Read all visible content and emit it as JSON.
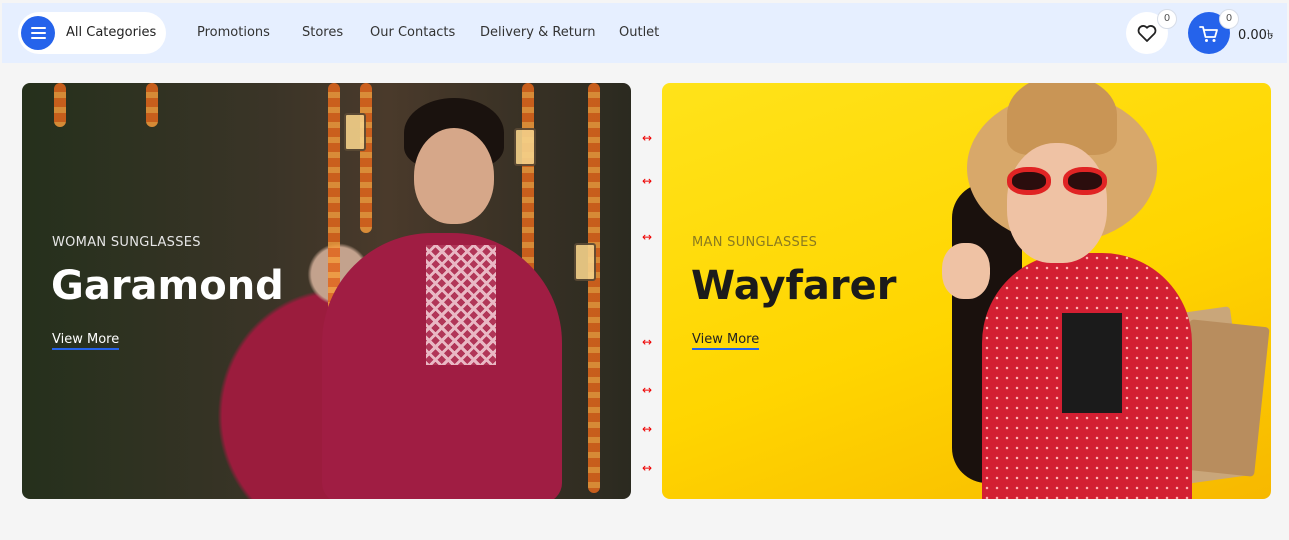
{
  "header": {
    "all_categories": "All Categories",
    "nav": [
      "Promotions",
      "Stores",
      "Our Contacts",
      "Delivery & Return",
      "Outlet"
    ],
    "wishlist_count": "0",
    "cart_count": "0",
    "cart_total": "0.00৳"
  },
  "banners": [
    {
      "subtitle": "WOMAN SUNGLASSES",
      "title": "Garamond",
      "link": "View More"
    },
    {
      "subtitle": "MAN SUNGLASSES",
      "title": "Wayfarer",
      "link": "View More"
    }
  ],
  "scroll_arrow": "↔",
  "colors": {
    "accent": "#2563eb",
    "header_bg": "#e6efff",
    "banner2_bg": "#ffd500"
  }
}
